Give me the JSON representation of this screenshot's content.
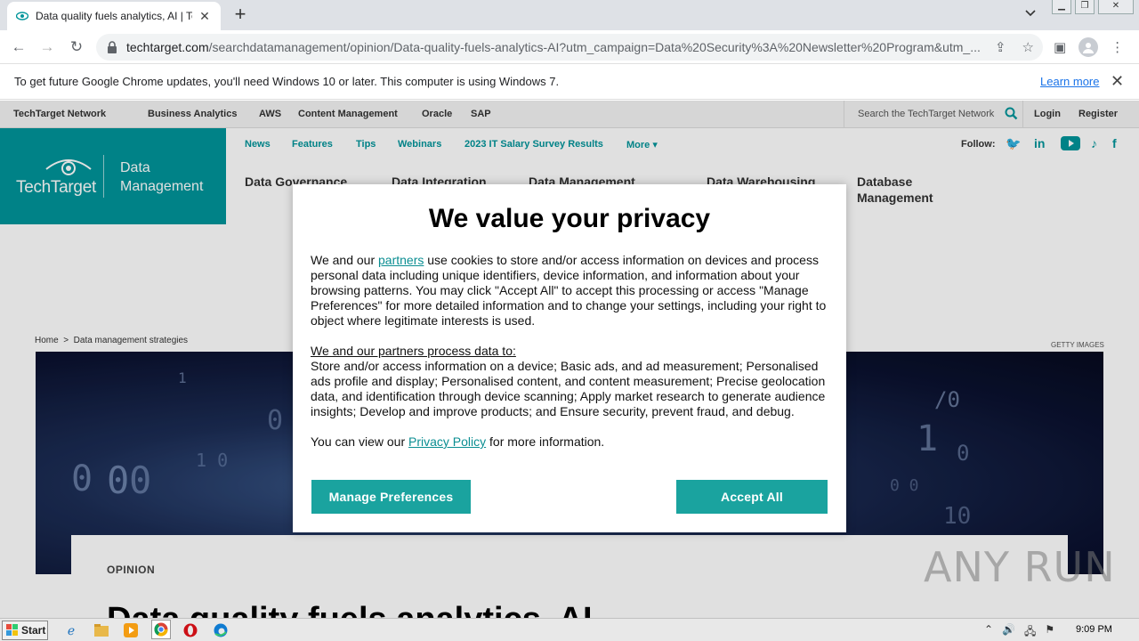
{
  "browser": {
    "tab_title": "Data quality fuels analytics, AI | Tec",
    "url_host": "techtarget.com",
    "url_path": "/searchdatamanagement/opinion/Data-quality-fuels-analytics-AI?utm_campaign=Data%20Security%3A%20Newsletter%20Program&utm_...",
    "infobar_text": "To get future Google Chrome updates, you'll need Windows 10 or later. This computer is using Windows 7.",
    "infobar_link": "Learn more"
  },
  "site": {
    "network_links": [
      "TechTarget Network",
      "Business Analytics",
      "AWS",
      "Content Management",
      "Oracle",
      "SAP"
    ],
    "search_placeholder": "Search the TechTarget Network",
    "login": "Login",
    "register": "Register",
    "logo_brand": "TechTarget",
    "logo_sub1": "Data",
    "logo_sub2": "Management",
    "nav": [
      "News",
      "Features",
      "Tips",
      "Webinars",
      "2023 IT Salary Survey Results",
      "More"
    ],
    "follow": "Follow:",
    "topics": [
      "Data Governance",
      "Data Integration",
      "Data Management",
      "Data Warehousing",
      "Database",
      "Management"
    ],
    "breadcrumb_home": "Home",
    "breadcrumb_sep": ">",
    "breadcrumb_section": "Data management strategies",
    "image_credit": "GETTY IMAGES",
    "article_type": "OPINION",
    "headline": "Data quality fuels analytics, AI"
  },
  "modal": {
    "title": "We value your privacy",
    "p1_pre": "We and our ",
    "p1_link": "partners",
    "p1_post": " use cookies to store and/or access information on devices and process personal data including unique identifiers, device information, and information about your browsing patterns. You may click \"Accept All\" to accept this processing or access \"Manage Preferences\" for more detailed information and to change your settings, including your right to object where legitimate interests is used.",
    "p2_heading": "We and our partners process data to:",
    "p2_body": "Store and/or access information on a device; Basic ads, and ad measurement; Personalised ads profile and display; Personalised content, and content measurement; Precise geolocation data, and identification through device scanning; Apply market research to generate audience insights; Develop and improve products; and Ensure security, prevent fraud, and debug.",
    "p3_pre": "You can view our ",
    "p3_link": "Privacy Policy",
    "p3_post": " for more information.",
    "manage_label": "Manage Preferences",
    "accept_label": "Accept All"
  },
  "watermark": "ANY RUN",
  "taskbar": {
    "start_label": "Start",
    "clock": "9:09 PM"
  }
}
